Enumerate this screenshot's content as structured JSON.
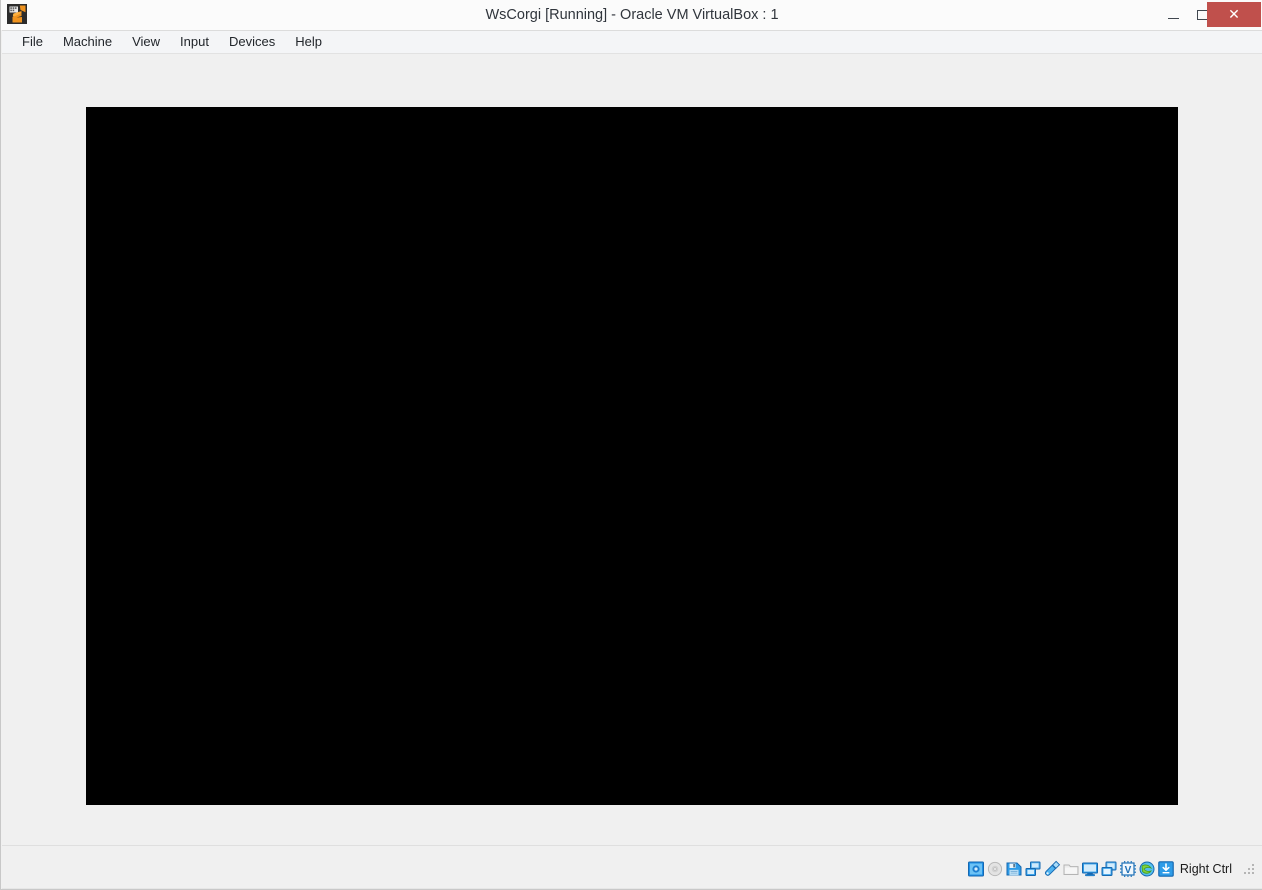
{
  "window": {
    "title": "WsCorgi [Running] - Oracle VM VirtualBox : 1",
    "app_icon": "virtualbox-icon",
    "controls": {
      "minimize_label": "–",
      "maximize_label": "□",
      "close_label": "✕",
      "close_color": "#c0504c"
    }
  },
  "menu": {
    "items": [
      {
        "label": "File",
        "name": "menu-file"
      },
      {
        "label": "Machine",
        "name": "menu-machine"
      },
      {
        "label": "View",
        "name": "menu-view"
      },
      {
        "label": "Input",
        "name": "menu-input"
      },
      {
        "label": "Devices",
        "name": "menu-devices"
      },
      {
        "label": "Help",
        "name": "menu-help"
      }
    ]
  },
  "display": {
    "state": "blank",
    "background_color": "#000000"
  },
  "status_bar": {
    "host_key_label": "Right Ctrl",
    "icons": [
      {
        "name": "hard-disk-icon",
        "title": "Hard Disks",
        "active": true
      },
      {
        "name": "optical-disk-icon",
        "title": "Optical Drives",
        "active": false
      },
      {
        "name": "floppy-disk-icon",
        "title": "Floppy Drives",
        "active": true
      },
      {
        "name": "network-icon",
        "title": "Network",
        "active": true
      },
      {
        "name": "usb-icon",
        "title": "USB Devices",
        "active": true
      },
      {
        "name": "shared-folders-icon",
        "title": "Shared Folders",
        "active": false
      },
      {
        "name": "display-icon",
        "title": "Display",
        "active": true
      },
      {
        "name": "recording-icon",
        "title": "Recording",
        "active": true
      },
      {
        "name": "virtualization-icon",
        "title": "Features",
        "active": true
      },
      {
        "name": "mouse-integration-icon",
        "title": "Mouse Integration",
        "active": true
      },
      {
        "name": "host-key-icon",
        "title": "Host Key",
        "active": true
      }
    ],
    "resize_grip": "resize-grip"
  },
  "colors": {
    "window_background": "#f0f0f0",
    "title_bar": "#fbfbfb",
    "menu_bar": "#f4f5f7",
    "close_button": "#c0504c",
    "text": "#22262b"
  }
}
